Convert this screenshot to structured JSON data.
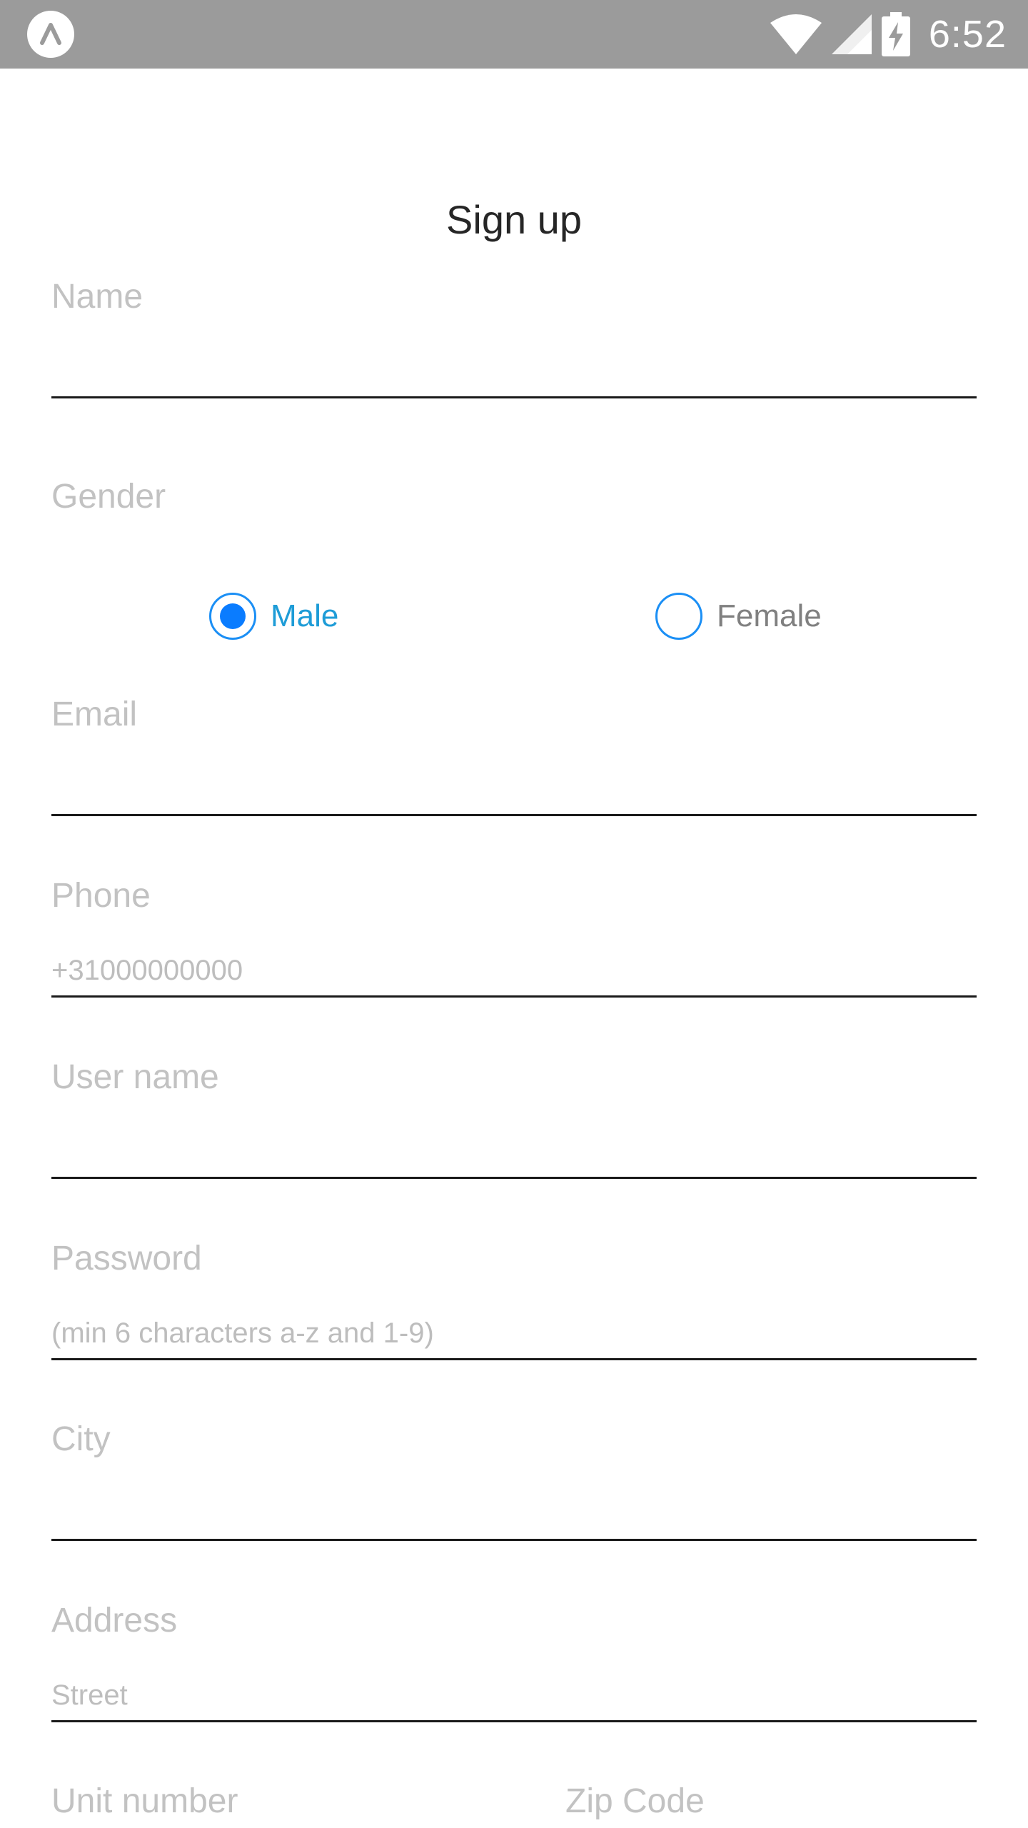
{
  "status_bar": {
    "time": "6:52",
    "icons": [
      "app-badge-icon",
      "wifi-icon",
      "signal-icon",
      "battery-charging-icon"
    ]
  },
  "page": {
    "title": "Sign up"
  },
  "form": {
    "name": {
      "label": "Name",
      "placeholder": ""
    },
    "gender": {
      "label": "Gender",
      "options": [
        {
          "label": "Male",
          "selected": true
        },
        {
          "label": "Female",
          "selected": false
        }
      ]
    },
    "email": {
      "label": "Email",
      "placeholder": ""
    },
    "phone": {
      "label": "Phone",
      "placeholder": "+31000000000"
    },
    "username": {
      "label": "User name",
      "placeholder": ""
    },
    "password": {
      "label": "Password",
      "placeholder": "(min 6 characters a-z and 1-9)"
    },
    "city": {
      "label": "City",
      "placeholder": ""
    },
    "address": {
      "label": "Address",
      "placeholder": "Street"
    },
    "unit_number": {
      "label": "Unit number"
    },
    "zip_code": {
      "label": "Zip Code"
    }
  },
  "colors": {
    "status_bar": "#9b9b9b",
    "label": "#c2c2c2",
    "radio_accent": "#0a7cff",
    "radio_active_text": "#1e9cd7",
    "underline": "#1a1a1a"
  }
}
